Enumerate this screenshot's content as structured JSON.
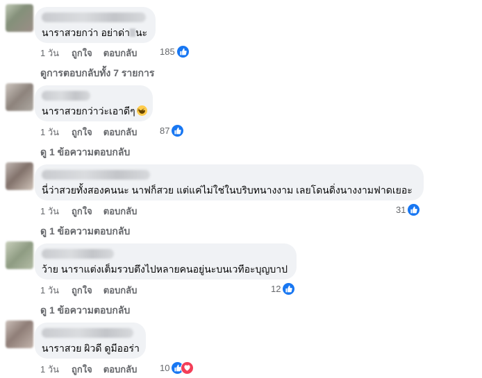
{
  "comments": [
    {
      "text_before": "นาราสวยกว่า อย่าด่า",
      "text_after": "นะ",
      "time": "1 วัน",
      "like_label": "ถูกใจ",
      "reply_label": "ตอบกลับ",
      "reaction_count": "185",
      "reactions": [
        "like-icon"
      ]
    },
    {
      "text": "นาราสวยกว่าว่ะเอาดีๆ",
      "emoji": "laughing-emoji-icon",
      "time": "1 วัน",
      "like_label": "ถูกใจ",
      "reply_label": "ตอบกลับ",
      "reaction_count": "87",
      "reactions": [
        "like-icon"
      ]
    },
    {
      "text": "นี่ว่าสวยทั้งสองคนนะ นาฟก็สวย แต่แค่ไม่ใช่ในบริบทนางงาม เลยโดนดิ่งนางงามฟาดเยอะ",
      "time": "1 วัน",
      "like_label": "ถูกใจ",
      "reply_label": "ตอบกลับ",
      "reaction_count": "31",
      "reactions": [
        "like-icon"
      ]
    },
    {
      "text": "ว้าย นาราแต่งเต็มรวบตึงไปหลายคนอยู่นะบนเวทีอะบุญบาป",
      "time": "1 วัน",
      "like_label": "ถูกใจ",
      "reply_label": "ตอบกลับ",
      "reaction_count": "12",
      "reactions": [
        "like-icon"
      ]
    },
    {
      "text": "นาราสวย ผิวดี ดูมีออร่า",
      "time": "1 วัน",
      "like_label": "ถูกใจ",
      "reply_label": "ตอบกลับ",
      "reaction_count": "10",
      "reactions": [
        "like-icon",
        "love-icon"
      ]
    }
  ],
  "view_replies": [
    "ดูการตอบกลับทั้ง 7 รายการ",
    "ดู 1 ข้อความตอบกลับ",
    "ดู 1 ข้อความตอบกลับ",
    "ดู 1 ข้อความตอบกลับ"
  ],
  "colors": {
    "bubble_bg": "#f0f2f5",
    "secondary_text": "#65676b",
    "like_blue": "#1877f2",
    "love_red": "#f33e58"
  }
}
